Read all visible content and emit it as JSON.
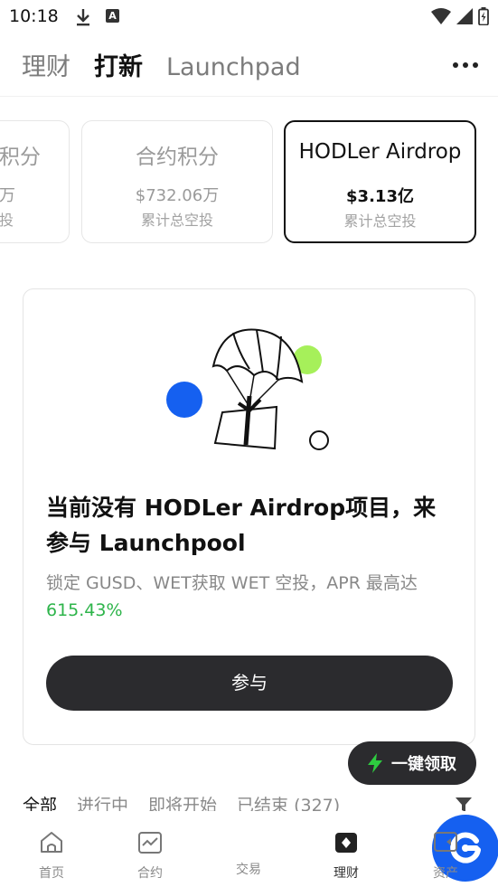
{
  "status_bar": {
    "time": "10:18",
    "a_badge": "A"
  },
  "top_tabs": [
    {
      "label": "理财",
      "active": false
    },
    {
      "label": "打新",
      "active": true
    },
    {
      "label": "Launchpad",
      "active": false
    }
  ],
  "cards": {
    "partial": {
      "title": "积分",
      "value": "万",
      "sub": "投"
    },
    "contract": {
      "title": "合约积分",
      "value": "$732.06万",
      "sub": "累计总空投"
    },
    "hodler": {
      "title": "HODLer Airdrop",
      "value": "$3.13亿",
      "sub": "累计总空投"
    }
  },
  "empty_state": {
    "title": "当前没有 HODLer Airdrop项目，来参与 Launchpool",
    "desc_prefix": "锁定 GUSD、WET获取 WET 空投，APR 最高达 ",
    "apr": "615.43%",
    "button": "参与"
  },
  "claim_button": {
    "label": "一键领取"
  },
  "filter_tabs": [
    {
      "label": "全部",
      "active": true
    },
    {
      "label": "进行中",
      "active": false
    },
    {
      "label": "即将开始",
      "active": false
    },
    {
      "label": "已结束 (327)",
      "active": false
    }
  ],
  "bottom_nav": [
    {
      "label": "首页",
      "icon": "home-icon"
    },
    {
      "label": "合约",
      "icon": "chart-icon"
    },
    {
      "label": "交易",
      "icon": "trade-icon"
    },
    {
      "label": "理财",
      "icon": "wallet-icon",
      "active": true
    },
    {
      "label": "资产",
      "icon": "assets-icon"
    }
  ],
  "colors": {
    "accent_blue": "#1560f0",
    "green": "#2db44a",
    "lime": "#a6f05a",
    "dark_button": "#2b2b2e"
  }
}
